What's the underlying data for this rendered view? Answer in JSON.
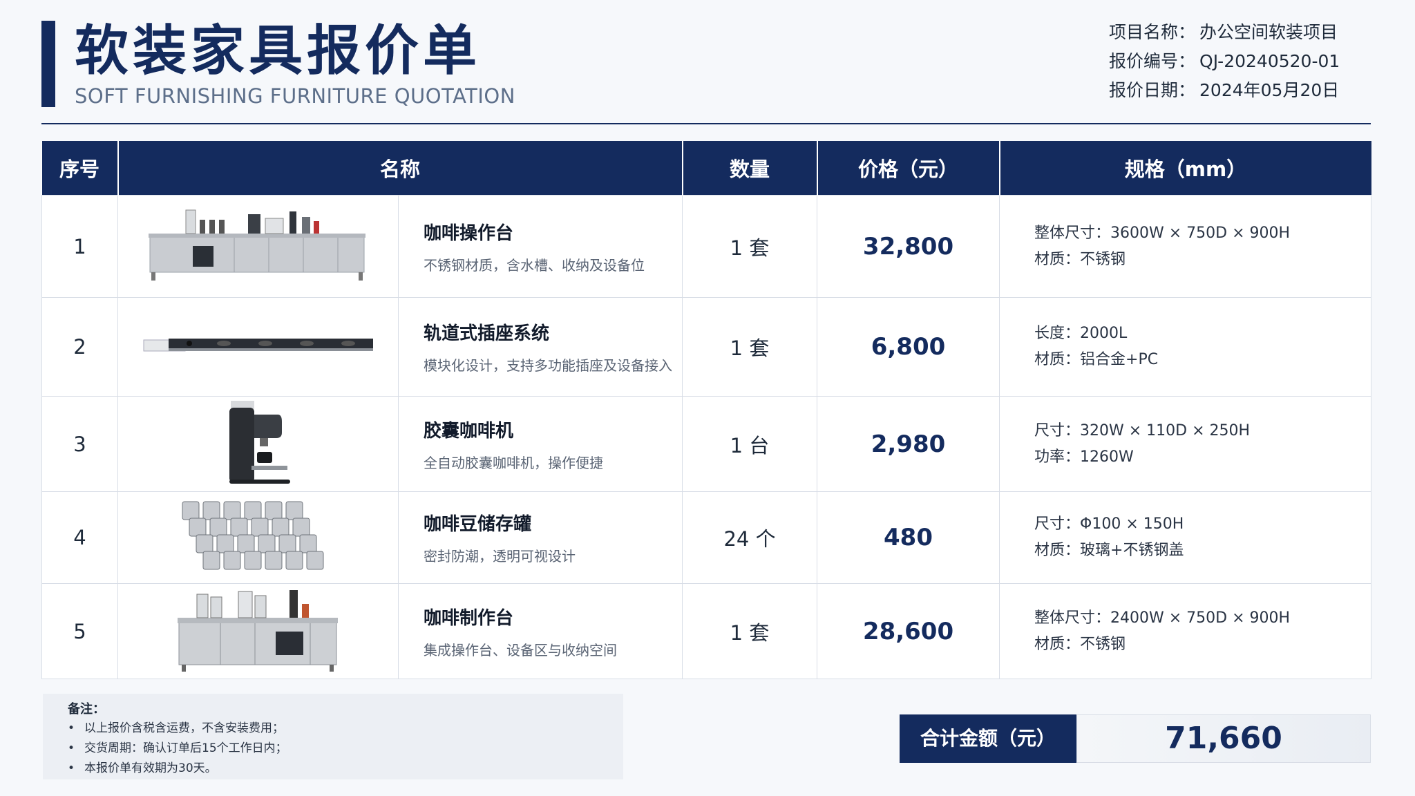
{
  "header": {
    "title": "软装家具报价单",
    "subtitle": "SOFT FURNISHING FURNITURE QUOTATION",
    "meta": [
      {
        "label": "项目名称：",
        "value": "办公空间软装项目"
      },
      {
        "label": "报价编号：",
        "value": "QJ-20240520-01"
      },
      {
        "label": "报价日期：",
        "value": "2024年05月20日"
      }
    ]
  },
  "table": {
    "headers": [
      "序号",
      "名称",
      "数量",
      "价格（元）",
      "规格（mm）"
    ],
    "rows": [
      {
        "no": "1",
        "image": "coffee-station-image",
        "name": "咖啡操作台",
        "desc": "不锈钢材质，含水槽、收纳及设备位",
        "qty": "1 套",
        "price": "32,800",
        "specs": [
          "整体尺寸：3600W × 750D × 900H",
          "材质：不锈钢"
        ]
      },
      {
        "no": "2",
        "image": "track-socket-image",
        "name": "轨道式插座系统",
        "desc": "模块化设计，支持多功能插座及设备接入",
        "qty": "1 套",
        "price": "6,800",
        "specs": [
          "长度：2000L",
          "材质：铝合金+PC"
        ]
      },
      {
        "no": "3",
        "image": "capsule-coffee-machine-image",
        "name": "胶囊咖啡机",
        "desc": "全自动胶囊咖啡机，操作便捷",
        "qty": "1 台",
        "price": "2,980",
        "specs": [
          "尺寸：320W × 110D × 250H",
          "功率：1260W"
        ]
      },
      {
        "no": "4",
        "image": "bean-jars-image",
        "name": "咖啡豆储存罐",
        "desc": "密封防潮，透明可视设计",
        "qty": "24 个",
        "price": "480",
        "specs": [
          "尺寸：Φ100 × 150H",
          "材质：玻璃+不锈钢盖"
        ]
      },
      {
        "no": "5",
        "image": "coffee-bar-image",
        "name": "咖啡制作台",
        "desc": "集成操作台、设备区与收纳空间",
        "qty": "1 套",
        "price": "28,600",
        "specs": [
          "整体尺寸：2400W × 750D × 900H",
          "材质：不锈钢"
        ]
      }
    ]
  },
  "notes": {
    "title": "备注：",
    "items": [
      "以上报价含税含运费，不含安装费用；",
      "交货周期：确认订单后15个工作日内；",
      "本报价单有效期为30天。"
    ],
    "bullet": "•"
  },
  "total": {
    "label": "合计金额（元）",
    "value": "71,660"
  },
  "colors": {
    "primary": "#142b5e",
    "background": "#f6f8fb"
  }
}
